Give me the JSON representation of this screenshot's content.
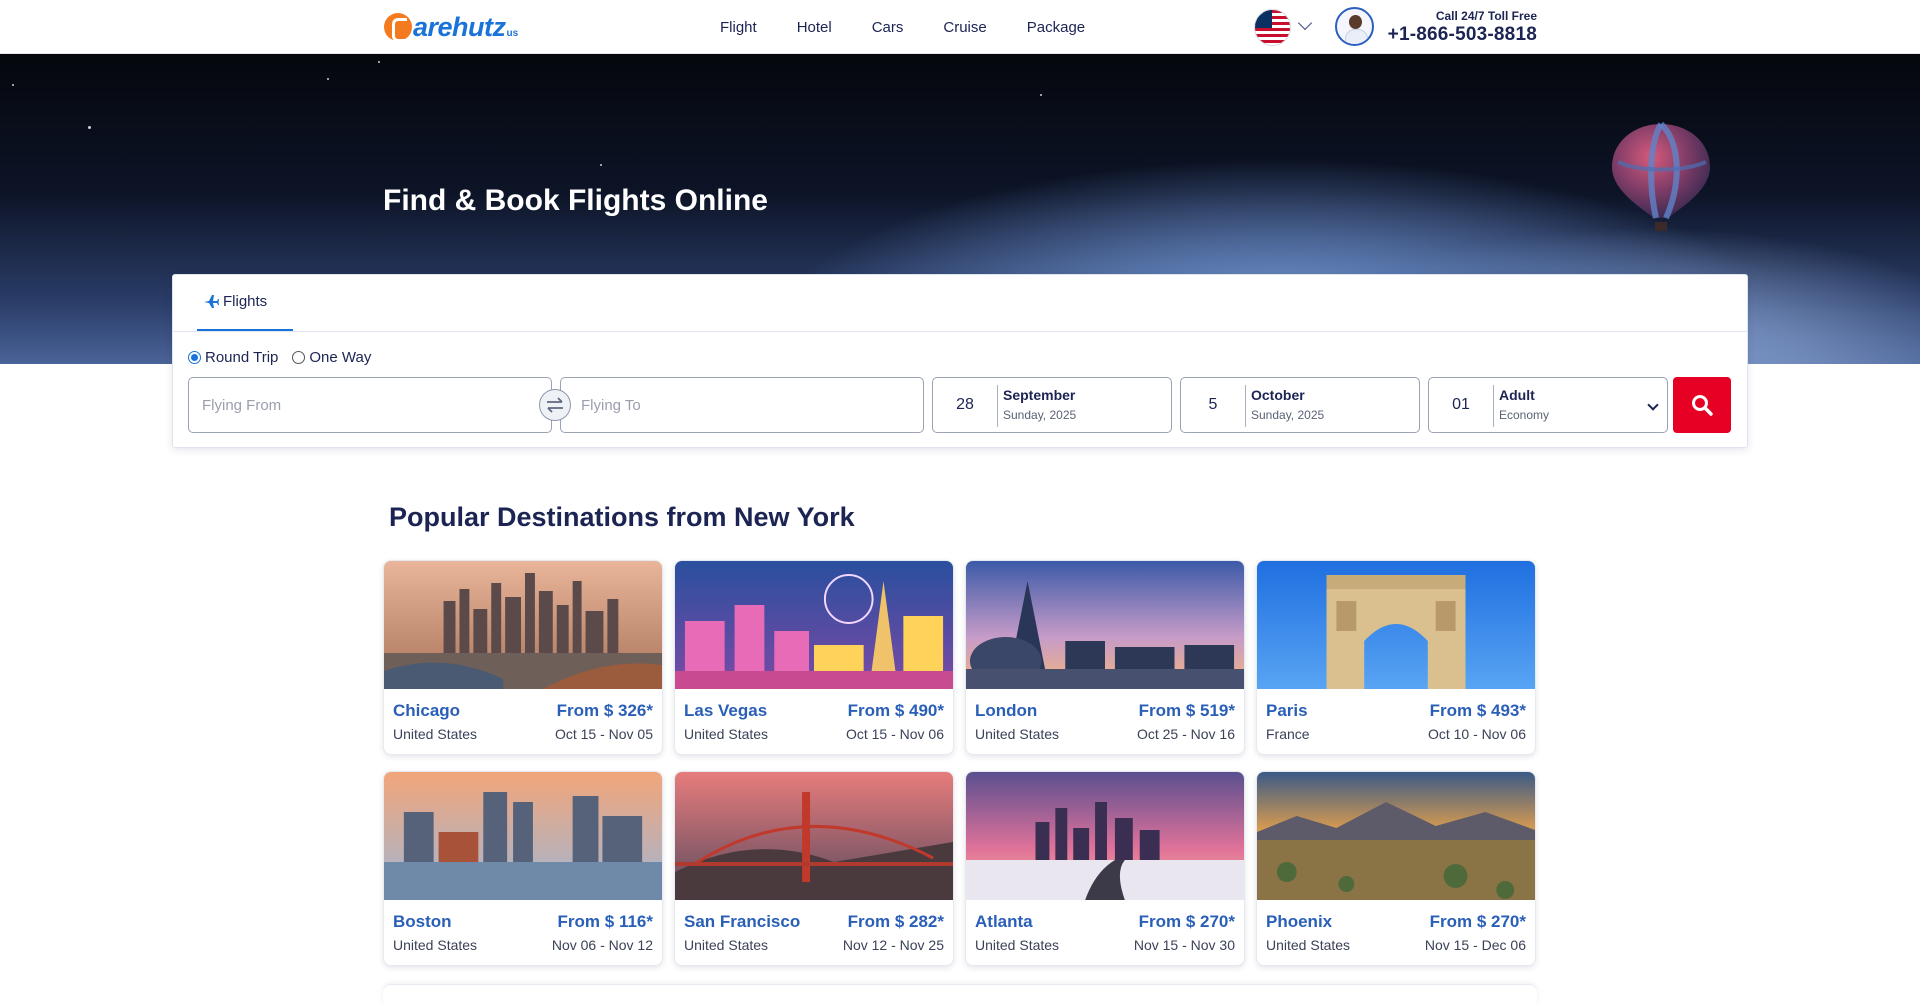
{
  "header": {
    "logo_text": "arehutz",
    "logo_suffix": "us",
    "nav": [
      "Flight",
      "Hotel",
      "Cars",
      "Cruise",
      "Package"
    ],
    "call_label": "Call 24/7 Toll Free",
    "call_number": "+1-866-503-8818",
    "icons": {
      "flag": "us-flag-icon",
      "chevron": "chevron-down-icon",
      "agent": "support-agent-avatar"
    }
  },
  "hero": {
    "title": "Find & Book Flights Online"
  },
  "search": {
    "tab_label": "Flights",
    "trip_types": [
      "Round Trip",
      "One Way"
    ],
    "selected_trip_type": "Round Trip",
    "from_placeholder": "Flying From",
    "to_placeholder": "Flying To",
    "depart": {
      "day": "28",
      "month": "September",
      "weekday_year": "Sunday, 2025"
    },
    "return": {
      "day": "5",
      "month": "October",
      "weekday_year": "Sunday, 2025"
    },
    "travelers": {
      "count": "01",
      "type": "Adult",
      "cabin": "Economy"
    },
    "colors": {
      "accent": "#1a73d9",
      "search_button": "#e60023"
    }
  },
  "destinations": {
    "title": "Popular Destinations from New York",
    "items": [
      {
        "city": "Chicago",
        "country": "United States",
        "price": "From $ 326*",
        "dates": "Oct 15 - Nov 05"
      },
      {
        "city": "Las Vegas",
        "country": "United States",
        "price": "From $ 490*",
        "dates": "Oct 15 - Nov 06"
      },
      {
        "city": "London",
        "country": "United States",
        "price": "From $ 519*",
        "dates": "Oct 25 - Nov 16"
      },
      {
        "city": "Paris",
        "country": "France",
        "price": "From $ 493*",
        "dates": "Oct 10 - Nov 06"
      },
      {
        "city": "Boston",
        "country": "United States",
        "price": "From $ 116*",
        "dates": "Nov 06 - Nov 12"
      },
      {
        "city": "San Francisco",
        "country": "United States",
        "price": "From $ 282*",
        "dates": "Nov 12 - Nov 25"
      },
      {
        "city": "Atlanta",
        "country": "United States",
        "price": "From $ 270*",
        "dates": "Nov 15 - Nov 30"
      },
      {
        "city": "Phoenix",
        "country": "United States",
        "price": "From $ 270*",
        "dates": "Nov 15 - Dec 06"
      }
    ]
  }
}
